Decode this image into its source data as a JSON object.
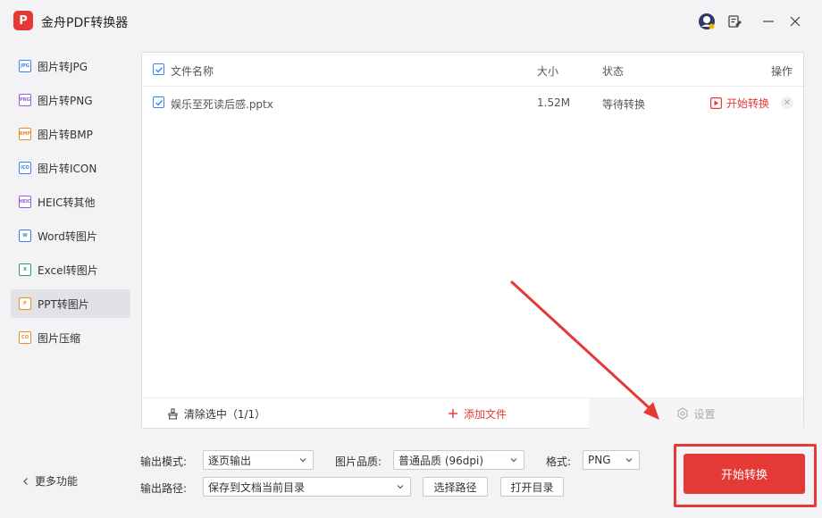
{
  "app": {
    "logo_text": "P",
    "title": "金舟PDF转换器"
  },
  "sidebar": {
    "items": [
      {
        "label": "图片转JPG",
        "icon": "jpg-icon",
        "icon_text": "JPG",
        "icon_color": "#3b82f6"
      },
      {
        "label": "图片转PNG",
        "icon": "png-icon",
        "icon_text": "PNG",
        "icon_color": "#9c5de0"
      },
      {
        "label": "图片转BMP",
        "icon": "bmp-icon",
        "icon_text": "BMP",
        "icon_color": "#f08a24"
      },
      {
        "label": "图片转ICON",
        "icon": "ico-icon",
        "icon_text": "ICO",
        "icon_color": "#3b82f6"
      },
      {
        "label": "HEIC转其他",
        "icon": "heic-icon",
        "icon_text": "HEIC",
        "icon_color": "#9c5de0"
      },
      {
        "label": "Word转图片",
        "icon": "word-icon",
        "icon_text": "W",
        "icon_color": "#3b82f6"
      },
      {
        "label": "Excel转图片",
        "icon": "excel-icon",
        "icon_text": "X",
        "icon_color": "#22a559"
      },
      {
        "label": "PPT转图片",
        "icon": "ppt-icon",
        "icon_text": "P",
        "icon_color": "#f08a24"
      },
      {
        "label": "图片压缩",
        "icon": "compress-icon",
        "icon_text": "CO",
        "icon_color": "#f08a24"
      }
    ],
    "active_index": 7,
    "more_label": "更多功能"
  },
  "file_table": {
    "columns": {
      "name": "文件名称",
      "size": "大小",
      "status": "状态",
      "action": "操作"
    },
    "rows": [
      {
        "name": "娱乐至死读后感.pptx",
        "size": "1.52M",
        "status": "等待转换",
        "action": "开始转换",
        "checked": true
      }
    ]
  },
  "actions": {
    "clear_label": "清除选中（1/1）",
    "add_label": "添加文件",
    "settings_label": "设置"
  },
  "options": {
    "output_mode_label": "输出模式:",
    "output_mode_value": "逐页输出",
    "quality_label": "图片品质:",
    "quality_value": "普通品质 (96dpi)",
    "format_label": "格式:",
    "format_value": "PNG",
    "path_label": "输出路径:",
    "path_value": "保存到文档当前目录",
    "choose_path_label": "选择路径",
    "open_dir_label": "打开目录"
  },
  "start_button": {
    "label": "开始转换"
  },
  "colors": {
    "accent": "#e53935",
    "checkbox": "#3b82f6"
  }
}
